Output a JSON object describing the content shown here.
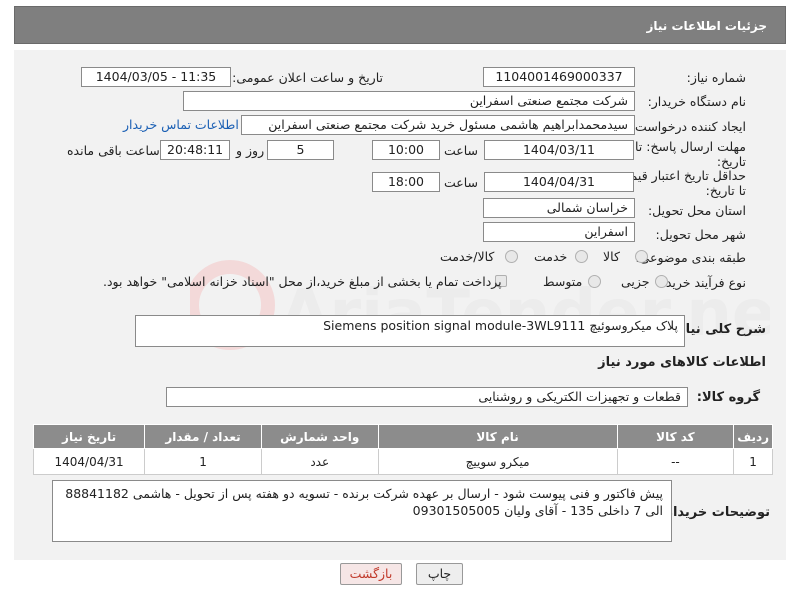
{
  "header": {
    "title": "جزئیات اطلاعات نیاز"
  },
  "fields": {
    "need_number_label": "شماره نیاز:",
    "need_number": "1104001469000337",
    "announce_label": "تاریخ و ساعت اعلان عمومی:",
    "announce_value": "1404/03/05 - 11:35",
    "buyer_org_label": "نام دستگاه خریدار:",
    "buyer_org": "شرکت مجتمع صنعتی اسفراین",
    "creator_label": "ایجاد کننده درخواست:",
    "creator": "سیدمحمدابراهیم هاشمی مسئول خرید شرکت مجتمع صنعتی اسفراین",
    "contact_link": "اطلاعات تماس خریدار",
    "reply_deadline_label": "مهلت ارسال پاسخ: تا تاریخ:",
    "reply_date": "1404/03/11",
    "time_label": "ساعت",
    "reply_time": "10:00",
    "days_value": "5",
    "days_label": "روز و",
    "remaining_time": "20:48:11",
    "remaining_label": "ساعت باقی مانده",
    "price_validity_label": "حداقل تاریخ اعتبار قیمت: تا تاریخ:",
    "price_date": "1404/04/31",
    "price_time": "18:00",
    "province_label": "استان محل تحویل:",
    "province": "خراسان شمالی",
    "city_label": "شهر محل تحویل:",
    "city": "اسفراین",
    "category_label": "طبقه بندی موضوعی:",
    "category_options": [
      "کالا",
      "خدمت",
      "کالا/خدمت"
    ],
    "process_label": "نوع فرآیند خرید :",
    "process_options": [
      "جزیی",
      "متوسط"
    ],
    "payment_note": "پرداخت تمام یا بخشی از مبلغ خرید،از محل \"اسناد خزانه اسلامی\" خواهد بود."
  },
  "description": {
    "label": "شرح کلی نیاز:",
    "value": "پلاک میکروسوئیچ Siemens position signal module-3WL9111"
  },
  "goods_info": {
    "title": "اطلاعات کالاهای مورد نیاز",
    "group_label": "گروه کالا:",
    "group_value": "قطعات و تجهیزات الکتریکی و روشنایی"
  },
  "table": {
    "headers": [
      "ردیف",
      "کد کالا",
      "نام کالا",
      "واحد شمارش",
      "تعداد / مقدار",
      "تاریخ نیاز"
    ],
    "rows": [
      [
        "1",
        "--",
        "میکرو سوییچ",
        "عدد",
        "1",
        "1404/04/31"
      ]
    ]
  },
  "buyer_notes": {
    "label": "توضیحات خریدار:",
    "value": "پیش فاکتور و فنی پیوست شود - ارسال بر عهده شرکت برنده - تسویه دو هفته پس از تحویل - هاشمی 88841182 الی 7 داخلی 135 - آقای ولیان 09301505005"
  },
  "buttons": {
    "print": "چاپ",
    "back": "بازگشت"
  },
  "colors": {
    "header_bg": "#7f7f7f",
    "link": "#1a5fb4",
    "back_button_text": "#c0392b"
  }
}
